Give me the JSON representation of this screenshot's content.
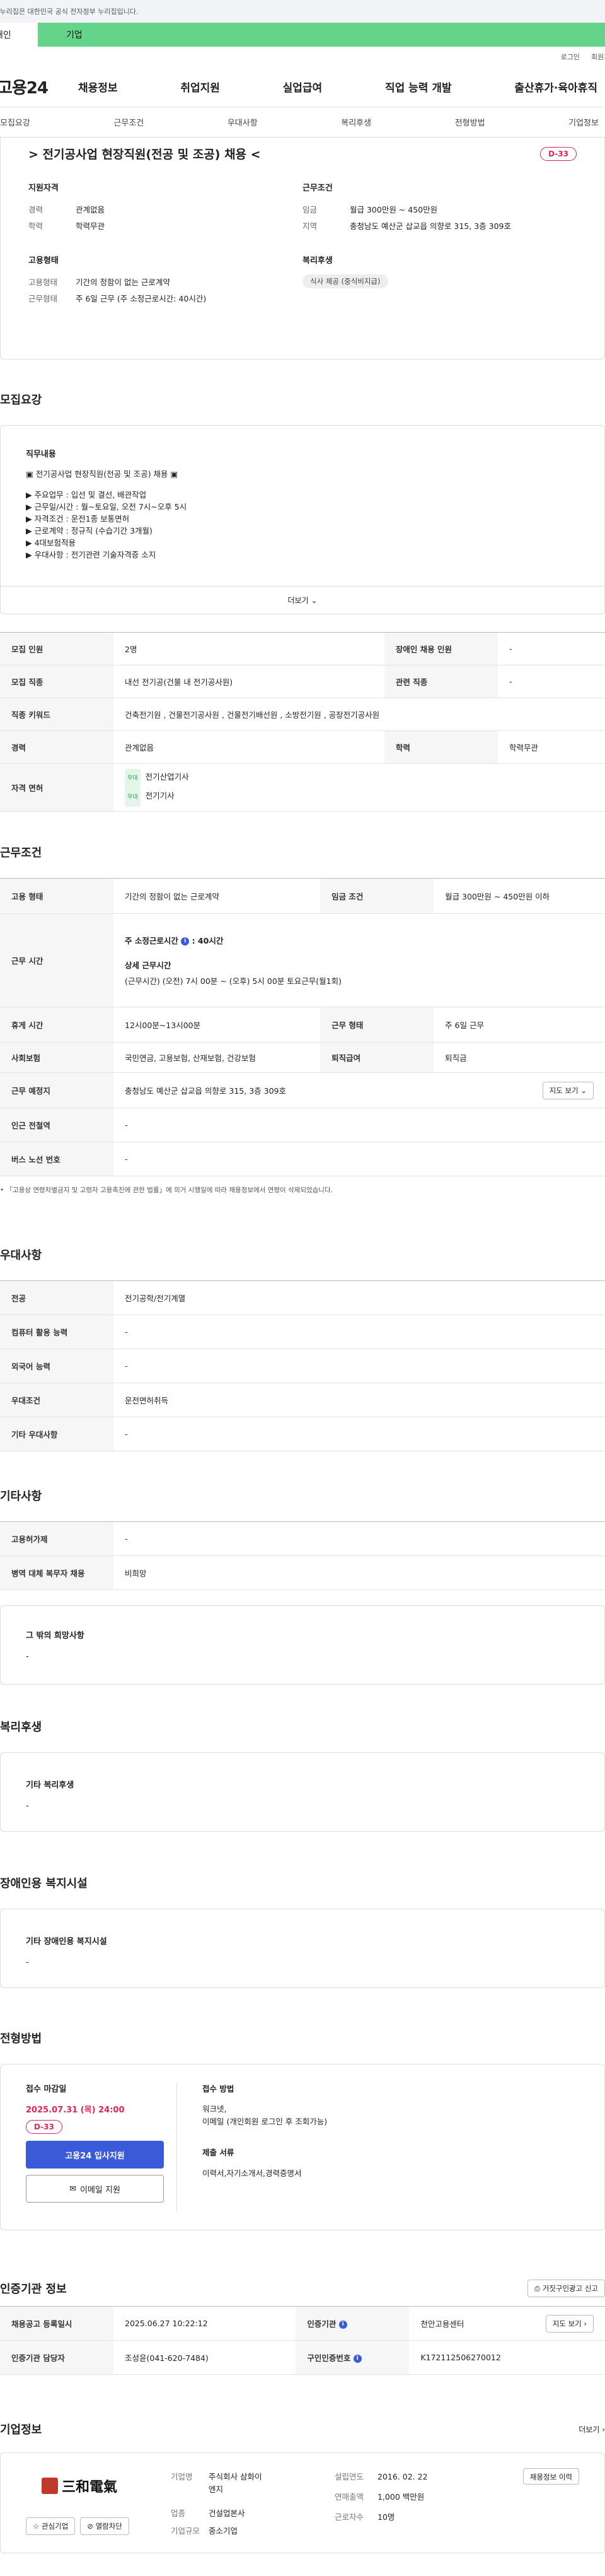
{
  "banner": {
    "text": "이 누리집은 대한민국 공식 전자정부 누리집입니다."
  },
  "user_tabs": {
    "individual": "개인",
    "business": "기업"
  },
  "util": {
    "login": "로그인",
    "join": "회원가입"
  },
  "gnb": {
    "logo": "고용24",
    "menu": [
      "채용정보",
      "취업지원",
      "실업급여",
      "직업 능력 개발",
      "출산휴가·육아휴직"
    ]
  },
  "anchor": [
    "모집요강",
    "근무조건",
    "우대사항",
    "복리후생",
    "전형방법",
    "기업정보"
  ],
  "job": {
    "title": "> 전기공사업 현장직원(전공 및 조공) 채용 <",
    "dday": "D-33"
  },
  "summary": {
    "qual": {
      "heading": "지원자격",
      "rows": [
        {
          "k": "경력",
          "v": "관계없음"
        },
        {
          "k": "학력",
          "v": "학력무관"
        }
      ]
    },
    "cond": {
      "heading": "근무조건",
      "rows": [
        {
          "k": "임금",
          "v": "월급 300만원 ~ 450만원"
        },
        {
          "k": "지역",
          "v": "충청남도 예산군 삽교읍 의향로 315, 3층 309호"
        }
      ]
    },
    "emp": {
      "heading": "고용형태",
      "rows": [
        {
          "k": "고용형태",
          "v": "기간의 정함이 없는 근로계약"
        },
        {
          "k": "근무형태",
          "v": "주 6일 근무 (주 소정근로시간: 40시간)"
        }
      ]
    },
    "welfare": {
      "heading": "복리후생",
      "chip": "식사 제공 (중식비지급)"
    }
  },
  "recruit": {
    "title": "모집요강",
    "duty_heading": "직무내용",
    "duty_lines": [
      "▣ 전기공사업 현장직원(전공 및 조공) 채용 ▣",
      "▶ 주요업무 : 입선 및 결선, 배관작업",
      "▶ 근무일/시간 : 월~토요일, 오전 7시~오후 5시",
      "▶ 자격조건 : 운전1종 보통면허",
      "▶ 근로계약 : 정규직 (수습기간 3개월)",
      "▶ 4대보험적용",
      "▶ 우대사항 : 전기관련 기술자격증 소지"
    ],
    "more": "더보기",
    "rows": {
      "count_k": "모집 인원",
      "count_v": "2명",
      "disabled_k": "장애인 채용 인원",
      "disabled_v": "-",
      "job_k": "모집 직종",
      "job_v": "내선 전기공(건물 내 전기공사원)",
      "related_k": "관련 직종",
      "related_v": "-",
      "kw_k": "직종 키워드",
      "kw_v": "건축전기원 , 건물전기공사원 , 건물전기배선원 , 소방전기원 , 공장전기공사원",
      "career_k": "경력",
      "career_v": "관계없음",
      "edu_k": "학력",
      "edu_v": "학력무관",
      "lic_k": "자격 면허",
      "lic_tag": "우대",
      "lic1": "전기산업기사",
      "lic2": "전기기사"
    }
  },
  "work": {
    "title": "근무조건",
    "emp_k": "고용 형태",
    "emp_v": "기간의 정함이 없는 근로계약",
    "wage_k": "임금 조건",
    "wage_v": "월급 300만원 ~ 450만원 이하",
    "time_k": "근무 시간",
    "time_main": "주 소정근로시간",
    "time_main_v": "40시간",
    "time_detail_k": "상세 근무시간",
    "time_detail_v": "(근무시간) (오전) 7시 00분 ~ (오후) 5시 00분 토요근무(월1회)",
    "rest_k": "휴게 시간",
    "rest_v": "12시00분~13시00분",
    "type_k": "근무 형태",
    "type_v": "주 6일 근무",
    "ins_k": "사회보험",
    "ins_v": "국민연금, 고용보험, 산재보험, 건강보험",
    "sev_k": "퇴직급여",
    "sev_v": "퇴직금",
    "place_k": "근무 예정지",
    "place_v": "충청남도 예산군 삽교읍 의향로 315, 3층 309호",
    "map_btn": "지도 보기",
    "subway_k": "인근 전철역",
    "subway_v": "-",
    "bus_k": "버스 노선 번호",
    "bus_v": "-",
    "note": "「고용상 연령차별금지 및 고령자 고용촉진에 관한 법률」에 의거 시행일에 따라 채용정보에서 연령이 삭제되었습니다."
  },
  "pref": {
    "title": "우대사항",
    "major_k": "전공",
    "major_v": "전기공학/전기계열",
    "pc_k": "컴퓨터 활용 능력",
    "pc_v": "-",
    "lang_k": "외국어 능력",
    "lang_v": "-",
    "cond_k": "우대조건",
    "cond_v": "운전면허취득",
    "etc_k": "기타 우대사항",
    "etc_v": "-"
  },
  "etc": {
    "title": "기타사항",
    "emp_k": "고용허가제",
    "emp_v": "-",
    "mil_k": "병역 대체 복무자 채용",
    "mil_v": "비희망",
    "hope_k": "그 밖의 희망사항",
    "hope_v": "-"
  },
  "welfare": {
    "title": "복리후생",
    "k": "기타 복리후생",
    "v": "-"
  },
  "disabled": {
    "title": "장애인용 복지시설",
    "k": "기타 장애인용 복지시설",
    "v": "-"
  },
  "process": {
    "title": "전형방법",
    "deadline_k": "접수 마감일",
    "deadline_v": "2025.07.31 (목) 24:00",
    "dday": "D-33",
    "apply_btn": "고용24 입사지원",
    "email_btn": "이메일 지원",
    "method_k": "접수 방법",
    "method_v1": "워크넷,",
    "method_v2": "이메일 (개인회원 로그인 후 조회가능)",
    "docs_k": "제출 서류",
    "docs_v": "이력서,자기소개서,경력증명서"
  },
  "agency": {
    "title": "인증기관 정보",
    "report_btn": "거짓구인광고 신고",
    "reg_k": "채용공고 등록일시",
    "reg_v": "2025.06.27 10:22:12",
    "org_k": "인증기관",
    "org_v": "천안고용센터",
    "map_btn": "지도 보기",
    "mgr_k": "인증기관 담당자",
    "mgr_v": "조성윤(041-620-7484)",
    "no_k": "구인인증번호",
    "no_v": "K172112506270012"
  },
  "company": {
    "title": "기업정보",
    "more": "더보기",
    "logo_text": "三和電氣",
    "fav_btn": "관심기업",
    "block_btn": "열람차단",
    "name_k": "기업명",
    "name_v1": "주식회사 삼화이",
    "name_v2": "엔지",
    "ind_k": "업종",
    "ind_v": "건설업본사",
    "size_k": "기업규모",
    "size_v": "중소기업",
    "est_k": "설립연도",
    "est_v": "2016. 02. 22",
    "sales_k": "연매출액",
    "sales_v": "1,000 백만원",
    "emp_k": "근로자수",
    "emp_v": "10명",
    "jobs_btn": "채용정보 이력"
  },
  "colors": {
    "accent": "#63d48a",
    "dday": "#e0245e",
    "primary": "#3a5bd9"
  }
}
